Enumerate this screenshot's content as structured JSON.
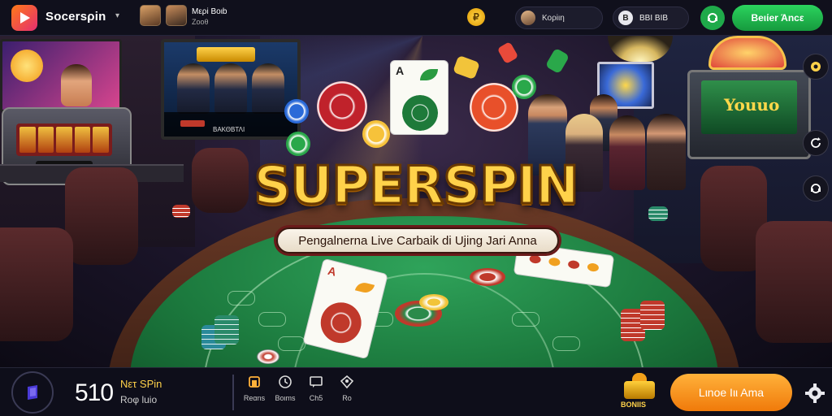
{
  "header": {
    "brand": "Sοcersρin",
    "promo": {
      "title": "Μερi Βοιb",
      "subtitle": "Ζοοθ"
    },
    "user": {
      "name": "Κορiιη"
    },
    "balance": {
      "icon_text": "Β",
      "amounts": "ΒΒΙ ΒΙΒ"
    },
    "signup_button": "Βeιίer Άncε",
    "coin_glyph": "₽"
  },
  "hero": {
    "headline": "SUPERSPIN",
    "tagline": "Pengalnerna Live Carbaik di Ujing Jari Anna",
    "tv_caption": "ΒΑΚΘΒΤΛΙ",
    "slot_text": "Youuo"
  },
  "bottom": {
    "big_number": "510",
    "next_title": "Νετ SPin",
    "next_sub": "Roφ luio",
    "nav": [
      {
        "label": "Reαns",
        "icon": "home-icon"
      },
      {
        "label": "Βοιms",
        "icon": "clock-icon"
      },
      {
        "label": "Ch5",
        "icon": "chat-icon"
      },
      {
        "label": "Ro",
        "icon": "diamond-icon"
      }
    ],
    "gift_label": "ΒΟΝΙΙS",
    "cta_button": "Lιnοe Ιιι Αma"
  },
  "colors": {
    "primary_green": "#1faa4a",
    "accent_orange": "#f07a0a",
    "headline_gold": "#ffd24a",
    "felt": "#1c7a3e"
  }
}
